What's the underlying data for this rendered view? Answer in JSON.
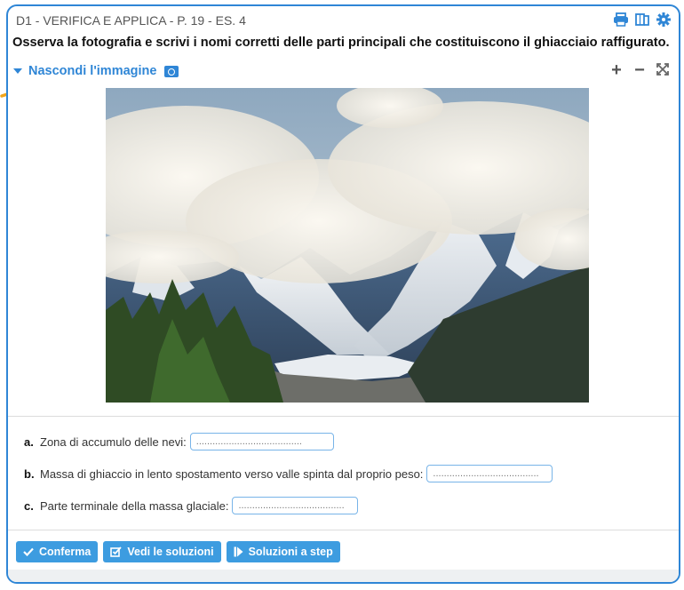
{
  "header": {
    "title": "D1 - VERIFICA E APPLICA - P. 19 - ES. 4",
    "icons": [
      "printer-icon",
      "book-icon",
      "gear-icon"
    ],
    "accent_color": "#2f86d6"
  },
  "question": "Osserva la fotografia e scrivi i nomi corretti delle parti principali che costituiscono il ghiacciaio raffigurato.",
  "image_toggle": {
    "label": "Nascondi l'immagine"
  },
  "zoom": {
    "plus": "+",
    "minus": "−",
    "fullscreen": "⤧"
  },
  "items": [
    {
      "letter": "a.",
      "text": "Zona di accumulo delle nevi:",
      "value": "",
      "placeholder": "......................................."
    },
    {
      "letter": "b.",
      "text": "Massa di ghiaccio in lento spostamento verso valle spinta dal proprio peso:",
      "value": "",
      "placeholder": "......................................."
    },
    {
      "letter": "c.",
      "text": "Parte terminale della massa glaciale:",
      "value": "",
      "placeholder": "......................................."
    }
  ],
  "buttons": {
    "confirm": "Conferma",
    "solutions": "Vedi le soluzioni",
    "steps": "Soluzioni a step"
  }
}
